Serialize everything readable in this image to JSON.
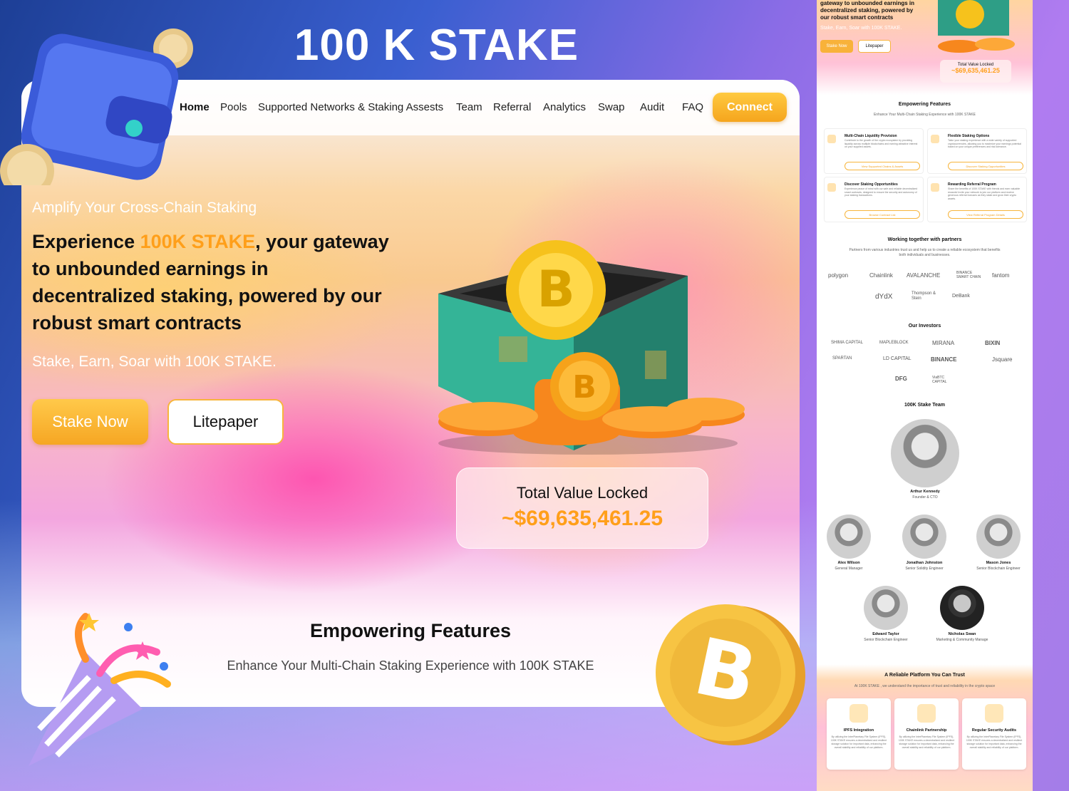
{
  "banner": {
    "title": "100 K STAKE"
  },
  "nav": {
    "links": [
      "Home",
      "Pools",
      "Supported Networks & Staking Assests",
      "Team",
      "Referral",
      "Analytics",
      "Swap",
      "Audit",
      "FAQ"
    ],
    "connect": "Connect"
  },
  "hero": {
    "tagline": "Amplify Your Cross-Chain Staking",
    "headline_pre": "Experience ",
    "headline_brand": "100K STAKE",
    "headline_post": ", your gateway to unbounded earnings in decentralized staking, powered by our robust smart contracts",
    "slogan": "Stake, Earn, Soar with 100K STAKE.",
    "stake_button": "Stake Now",
    "litepaper_button": "Litepaper",
    "tvl_label": "Total Value Locked",
    "tvl_value": "~$69,635,461.25"
  },
  "features": {
    "title": "Empowering Features",
    "subtitle": "Enhance Your Multi-Chain Staking Experience with 100K STAKE"
  },
  "side": {
    "headline": "gateway to unbounded earnings in decentralized staking, powered by our robust smart contracts",
    "slogan": "Stake, Earn, Soar with 100K STAKE.",
    "stake_button": "Stake Now",
    "litepaper_button": "Litepaper",
    "tvl_label": "Total Value Locked",
    "tvl_value": "~$69,635,461.25",
    "features_title": "Empowering Features",
    "features_sub": "Enhance Your Multi-Chain Staking Experience with 100K STAKE",
    "feature_cards": [
      {
        "title": "Multi-Chain Liquidity Provision",
        "desc": "Contribute to the growth of the crypto ecosystem by providing liquidity across multiple blockchains and earning attractive interest on your supplied assets.",
        "button": "View Supported Chains & Assets"
      },
      {
        "title": "Flexible Staking Options",
        "desc": "Tailor your staking experience with a wide variety of supported cryptocurrencies, allowing you to maximize your earnings potential based on your unique preferences and risk tolerance.",
        "button": "Discover Staking Opportunities"
      },
      {
        "title": "Discover Staking Opportunities",
        "desc": "Experience peace of mind with our safe and reliable decentralized smart contracts, designed to ensure the security and autonomy of your staking transactions.",
        "button": "Browse Contract List"
      },
      {
        "title": "Rewarding Referral Program",
        "desc": "Share the benefits of 100K STAKE with friends and earn valuable rewards! Invite your network to join our platform and receive generous referral bonuses as they stake and grow their crypto assets.",
        "button": "View Referral Program Details"
      }
    ],
    "partners_title": "Working together with partners",
    "partners_sub": "Partners from various industries trust us and help us to create a reliable ecosystem that benefits both individuals and businesses.",
    "partners": [
      "polygon",
      "Chainlink",
      "AVALANCHE",
      "BINANCE SMART CHAIN",
      "fantom",
      "dYdX",
      "Thompson & Stein",
      "DeBank"
    ],
    "investors_title": "Our Investors",
    "investors": [
      "SHIMA CAPITAL",
      "MAPLEBLOCK",
      "MIRANA",
      "BIXIN",
      "SPARTAN",
      "LD CAPITAL",
      "BINANCE",
      "Jsquare",
      "DFG",
      "ViaBTC CAPITAL"
    ],
    "team_title": "100K Stake Team",
    "team": [
      {
        "name": "Arthur Kennedy",
        "role": "Founder & CTO"
      },
      {
        "name": "Alex Wilson",
        "role": "General Manager"
      },
      {
        "name": "Jonathan Johnston",
        "role": "Senior Solidity Engineer"
      },
      {
        "name": "Mason Jones",
        "role": "Senior Blockchain Engineer"
      },
      {
        "name": "Edward Taylor",
        "role": "Senior Blockchain Engineer"
      },
      {
        "name": "Nicholas Swan",
        "role": "Marketing & Community Manage"
      }
    ],
    "trust_title": "A Reliable Platform You Can Trust",
    "trust_sub": "At 100K STAKE , we understand the importance of trust and reliability in the crypto space",
    "trust_cards": [
      {
        "title": "IPFS Integration",
        "desc": "By utilizing the InterPlanetary File System (IPFS), 100K STAKE ensures a decentralized and resilient storage solution for important data, enhancing the overall stability and reliability of our platform."
      },
      {
        "title": "Chainlink Partnership",
        "desc": "By utilizing the InterPlanetary File System (IPFS), 100K STAKE ensures a decentralized and resilient storage solution for important data, enhancing the overall stability and reliability of our platform."
      },
      {
        "title": "Regular Security Audits",
        "desc": "By utilizing the InterPlanetary File System (IPFS), 100K STAKE ensures a decentralized and resilient storage solution for important data, enhancing the overall stability and reliability of our platform."
      }
    ]
  },
  "colors": {
    "accent": "#ff9f1a",
    "button": "#f8b23a",
    "text": "#111111"
  }
}
